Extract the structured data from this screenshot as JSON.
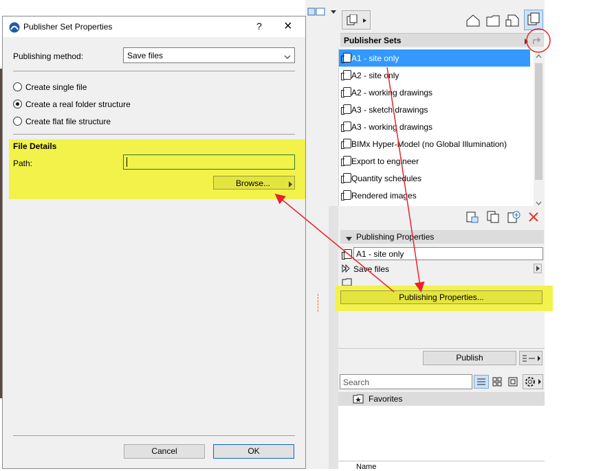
{
  "dialog": {
    "title": "Publisher Set Properties",
    "help_label": "?",
    "close_label": "×",
    "publishing_method_label": "Publishing method:",
    "publishing_method_value": "Save files",
    "options": [
      {
        "label": "Create single file",
        "selected": false
      },
      {
        "label": "Create a real folder structure",
        "selected": true
      },
      {
        "label": "Create flat file structure",
        "selected": false
      }
    ],
    "file_details_heading": "File Details",
    "path_label": "Path:",
    "path_value": "",
    "browse_label": "Browse...",
    "cancel_label": "Cancel",
    "ok_label": "OK"
  },
  "panel": {
    "publisher_sets_heading": "Publisher Sets",
    "sets": [
      {
        "label": "A1 - site only",
        "selected": true
      },
      {
        "label": "A2 - site only",
        "selected": false
      },
      {
        "label": "A2 - working drawings",
        "selected": false
      },
      {
        "label": "A3 - sketch drawings",
        "selected": false
      },
      {
        "label": "A3 - working drawings",
        "selected": false
      },
      {
        "label": "BIMx Hyper-Model (no Global Illumination)",
        "selected": false
      },
      {
        "label": "Export to engineer",
        "selected": false
      },
      {
        "label": "Quantity schedules",
        "selected": false
      },
      {
        "label": "Rendered images",
        "selected": false
      }
    ],
    "publishing_properties_heading": "Publishing Properties",
    "set_name_value": "A1 - site only",
    "save_files_label": "Save files",
    "publishing_properties_button": "Publishing Properties...",
    "publish_button": "Publish",
    "search_placeholder": "Search",
    "favorites_label": "Favorites",
    "name_column": "Name"
  },
  "colors": {
    "highlight": "#f2f24b",
    "selection": "#3399ff",
    "arrow": "#e8222a",
    "accent_border": "#0a64c8"
  },
  "icons": [
    "app-icon",
    "help-icon",
    "close-icon",
    "chevron-down-icon",
    "caret-right-icon",
    "document-set-icon",
    "house-icon",
    "folder-icon",
    "page-icon",
    "layout-book-icon",
    "view-map-icon",
    "scroll-up-icon",
    "new-set-icon",
    "duplicate-set-icon",
    "add-set-icon",
    "delete-icon",
    "collapse-triangle-icon",
    "fast-forward-icon",
    "folder-outline-icon",
    "list-view-icon",
    "grid-view-icon",
    "preview-icon",
    "settings-gear-icon",
    "star-folder-icon"
  ]
}
